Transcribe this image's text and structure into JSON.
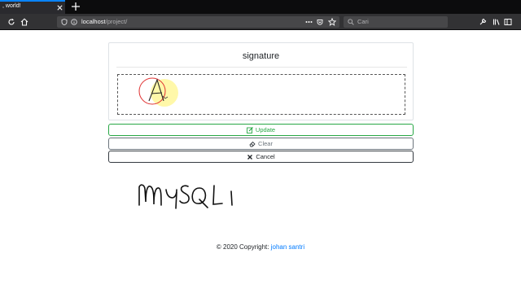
{
  "browser": {
    "tab_title": ", world!",
    "url_host": "localhost",
    "url_path": "/project/",
    "search_placeholder": "Cari",
    "accent": "#0a84ff"
  },
  "card": {
    "title": "signature"
  },
  "buttons": {
    "update": "Update",
    "clear": "Clear",
    "cancel": "Cancel"
  },
  "footer": {
    "copyright": "© 2020 Copyright:",
    "author": "johan santri"
  },
  "colors": {
    "success": "#28a745",
    "secondary": "#6c757d",
    "dark": "#343a40",
    "link": "#007bff"
  }
}
